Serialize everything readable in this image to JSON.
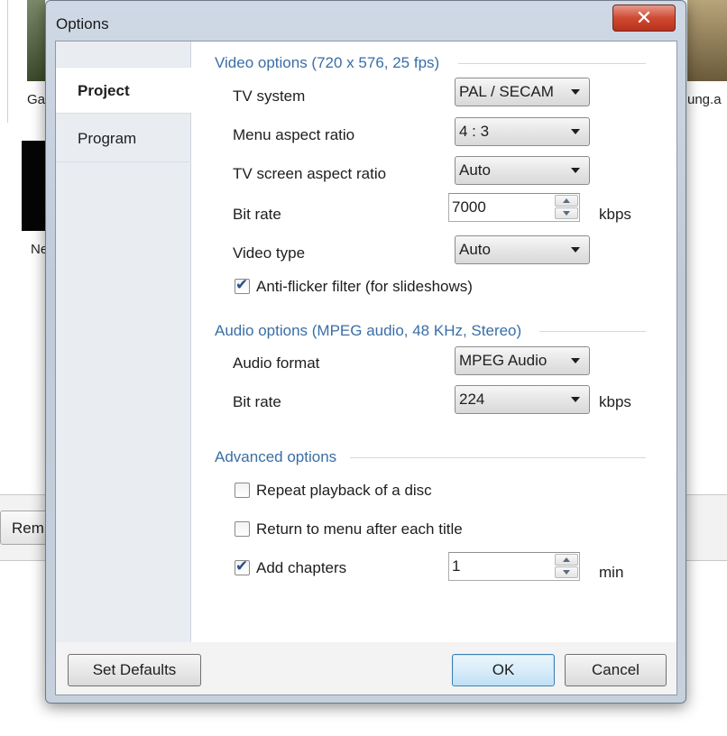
{
  "background": {
    "labels": [
      "Ga",
      "Ne",
      "ung.a"
    ],
    "button_label": "Rem"
  },
  "dialog": {
    "title": "Options",
    "close_glyph": "✕",
    "nav": [
      {
        "label": "Project",
        "active": true
      },
      {
        "label": "Program",
        "active": false
      }
    ],
    "video": {
      "title": "Video options (720 x 576, 25 fps)",
      "tv_system": {
        "label": "TV system",
        "value": "PAL / SECAM"
      },
      "menu_aspect": {
        "label": "Menu aspect ratio",
        "value": "4 : 3"
      },
      "tv_screen_aspect": {
        "label": "TV screen aspect ratio",
        "value": "Auto"
      },
      "bitrate": {
        "label": "Bit rate",
        "value": "7000",
        "unit": "kbps"
      },
      "video_type": {
        "label": "Video type",
        "value": "Auto"
      },
      "anti_flicker": {
        "label": "Anti-flicker filter (for slideshows)",
        "checked": true
      }
    },
    "audio": {
      "title": "Audio options (MPEG audio, 48 KHz, Stereo)",
      "format": {
        "label": "Audio format",
        "value": "MPEG Audio"
      },
      "bitrate": {
        "label": "Bit rate",
        "value": "224",
        "unit": "kbps"
      }
    },
    "advanced": {
      "title": "Advanced options",
      "repeat_playback": {
        "label": "Repeat playback of a disc",
        "checked": false
      },
      "return_to_menu": {
        "label": "Return to menu after each title",
        "checked": false
      },
      "add_chapters": {
        "label": "Add chapters",
        "checked": true,
        "value": "1",
        "unit": "min"
      }
    },
    "buttons": {
      "set_defaults": "Set Defaults",
      "ok": "OK",
      "cancel": "Cancel"
    },
    "check_glyph": "✔",
    "colors": {
      "section_title": "#3a6ea5",
      "close_button": "#cf4a33",
      "default_button_border": "#3c7fb1"
    }
  }
}
